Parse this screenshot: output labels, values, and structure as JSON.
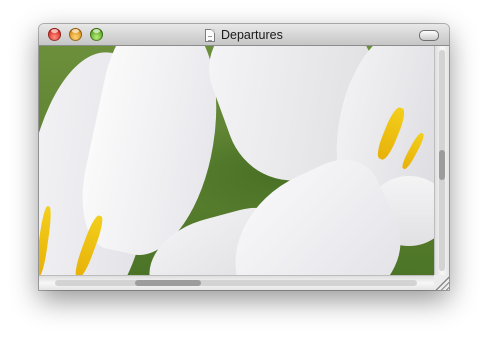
{
  "window": {
    "title": "Departures",
    "title_icon": "document-icon",
    "buttons": [
      "close",
      "minimize",
      "zoom"
    ],
    "toolbar_toggle": "toolbar-toggle-icon"
  },
  "content": {
    "subject": "white-flower-photo",
    "colors": {
      "petal": "#eeedf0",
      "stamen": "#efc213",
      "foliage": "#5a8131"
    }
  },
  "scrollbars": {
    "vertical": {
      "position": 0.5
    },
    "horizontal": {
      "position": 0.25
    }
  },
  "traffic_colors": {
    "close": "#e0443a",
    "minimize": "#f2a735",
    "zoom": "#7dc540"
  }
}
